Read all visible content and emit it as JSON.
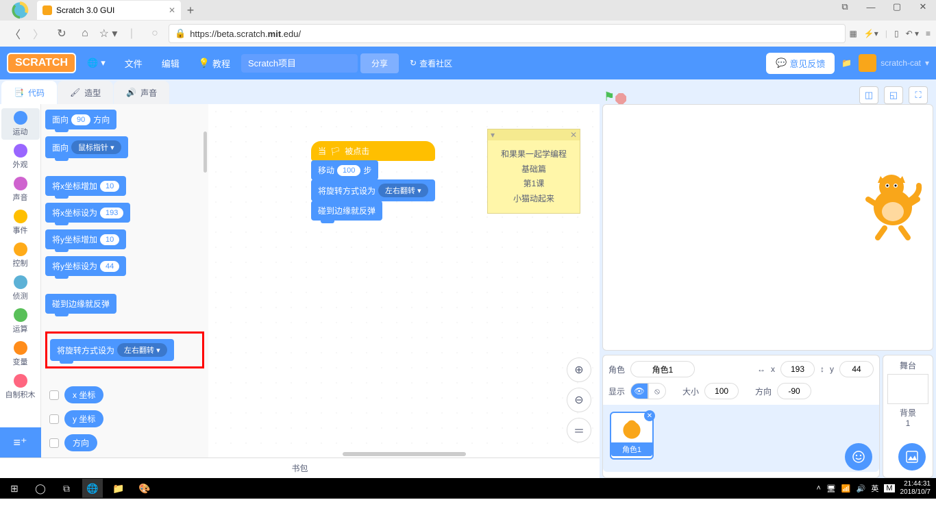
{
  "browser": {
    "tab_title": "Scratch 3.0 GUI",
    "url_prefix": "https://",
    "url_host": "beta.scratch.",
    "url_bold": "mit",
    "url_suffix": ".edu/"
  },
  "header": {
    "logo": "SCRATCH",
    "globe": "🌐",
    "file": "文件",
    "edit": "编辑",
    "tutorials": "教程",
    "project_placeholder": "Scratch项目",
    "share": "分享",
    "community": "查看社区",
    "feedback": "意见反馈",
    "username": "scratch-cat"
  },
  "tabs": {
    "code": "代码",
    "costumes": "造型",
    "sounds": "声音"
  },
  "categories": [
    {
      "label": "运动",
      "color": "#4c97ff"
    },
    {
      "label": "外观",
      "color": "#9966ff"
    },
    {
      "label": "声音",
      "color": "#cf63cf"
    },
    {
      "label": "事件",
      "color": "#ffbf00"
    },
    {
      "label": "控制",
      "color": "#ffab19"
    },
    {
      "label": "侦测",
      "color": "#5cb1d6"
    },
    {
      "label": "运算",
      "color": "#59c059"
    },
    {
      "label": "变量",
      "color": "#ff8c1a"
    },
    {
      "label": "自制积木",
      "color": "#ff6680"
    }
  ],
  "palette": {
    "b1_pre": "面向",
    "b1_val": "90",
    "b1_post": "方向",
    "b2_pre": "面向",
    "b2_dd": "鼠标指针 ▾",
    "b3_pre": "将x坐标增加",
    "b3_val": "10",
    "b4_pre": "将x坐标设为",
    "b4_val": "193",
    "b5_pre": "将y坐标增加",
    "b5_val": "10",
    "b6_pre": "将y坐标设为",
    "b6_val": "44",
    "b7": "碰到边缘就反弹",
    "b8_pre": "将旋转方式设为",
    "b8_dd": "左右翻转 ▾",
    "r1": "x 坐标",
    "r2": "y 坐标",
    "r3": "方向"
  },
  "script": {
    "hat": "当",
    "hat2": "被点击",
    "s1_pre": "移动",
    "s1_val": "100",
    "s1_post": "步",
    "s2_pre": "将旋转方式设为",
    "s2_dd": "左右翻转 ▾",
    "s3": "碰到边缘就反弹"
  },
  "note": {
    "l1": "和果果一起学编程",
    "l2": "基础篇",
    "l3": "第1课",
    "l4": "小猫动起来"
  },
  "backpack": "书包",
  "sprite_info": {
    "label_sprite": "角色",
    "name": "角色1",
    "label_x": "x",
    "x": "193",
    "label_y": "y",
    "y": "44",
    "label_show": "显示",
    "label_size": "大小",
    "size": "100",
    "label_dir": "方向",
    "dir": "-90"
  },
  "stage_panel": {
    "title": "舞台",
    "bg_label": "背景",
    "bg_count": "1"
  },
  "taskbar": {
    "time": "21:44:31",
    "date": "2018/10/7",
    "ime": "英",
    "m": "M"
  }
}
